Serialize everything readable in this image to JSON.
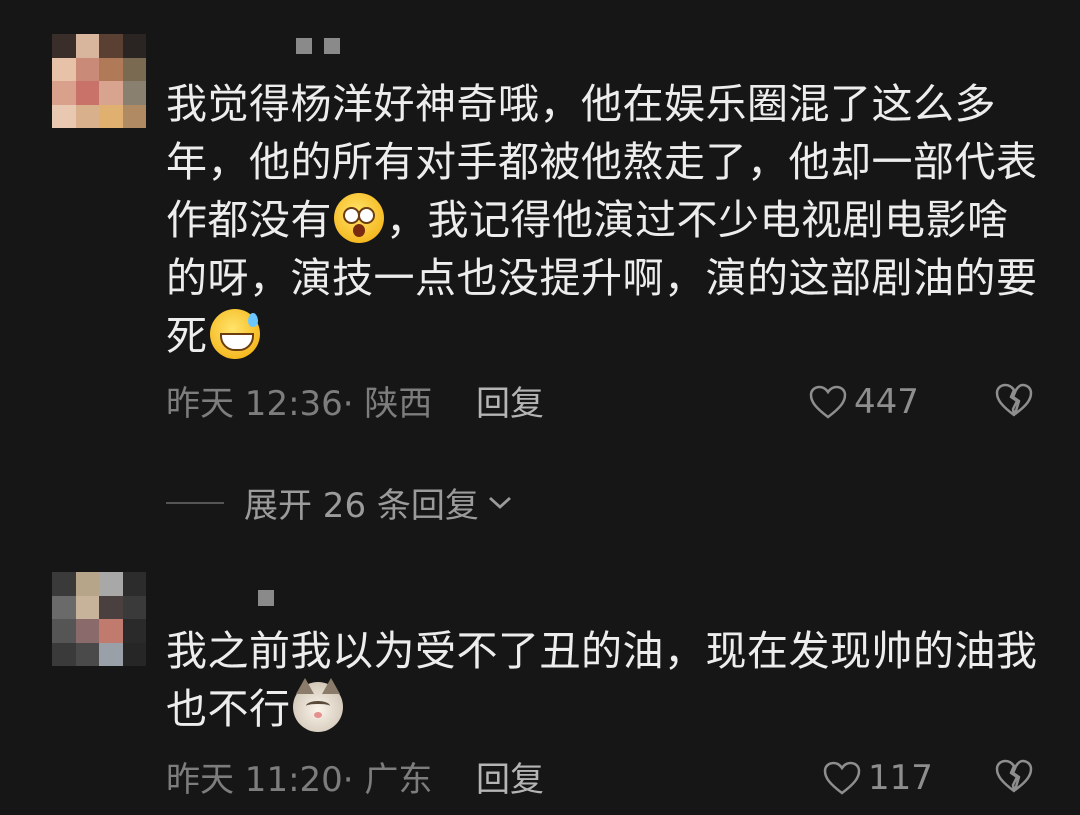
{
  "comments": [
    {
      "text_parts": [
        "我觉得杨洋好神奇哦，他在娱乐圈混了这么多年，他的所有对手都被他熬走了，他却一部代表作都没有",
        "，我记得他演过不少电视剧电影啥的呀，演技一点也没提升啊，演的这部剧油的要死"
      ],
      "emojis": [
        "shocked-face-icon",
        "grinning-sweat-icon"
      ],
      "time_location": "昨天 12:36· 陕西",
      "reply_label": "回复",
      "like_count": "447"
    },
    {
      "text_parts": [
        "我之前我以为受不了丑的油，现在发现帅的油我也不行"
      ],
      "emojis": [
        "cat-face-icon"
      ],
      "time_location": "昨天 11:20· 广东",
      "reply_label": "回复",
      "like_count": "117"
    }
  ],
  "expand_replies": {
    "label": "展开 26 条回复"
  },
  "colors": {
    "background": "#161616",
    "text": "#ededed",
    "meta": "#7d7d7d"
  }
}
